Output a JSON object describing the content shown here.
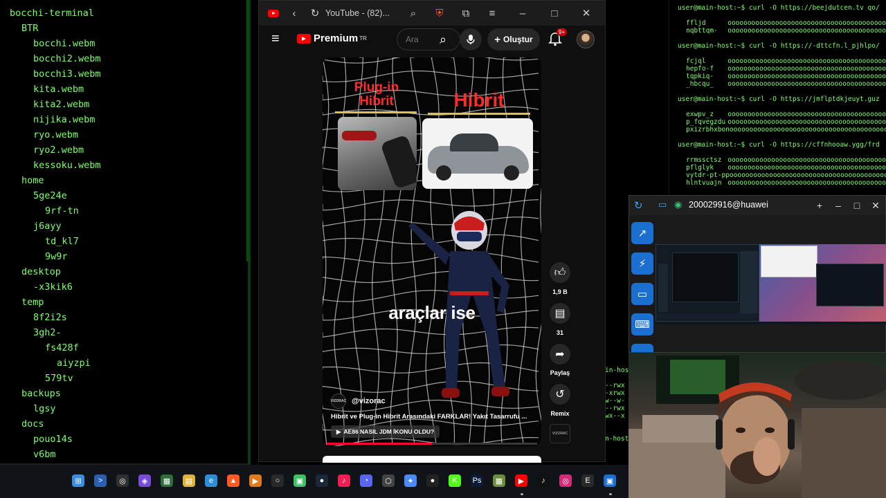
{
  "tree": {
    "title": "bocchi-terminal",
    "rows": [
      {
        "text": "BTR",
        "indent": 1
      },
      {
        "text": "bocchi.webm",
        "indent": 2
      },
      {
        "text": "bocchi2.webm",
        "indent": 2
      },
      {
        "text": "bocchi3.webm",
        "indent": 2
      },
      {
        "text": "kita.webm",
        "indent": 2
      },
      {
        "text": "kita2.webm",
        "indent": 2
      },
      {
        "text": "nijika.webm",
        "indent": 2
      },
      {
        "text": "ryo.webm",
        "indent": 2
      },
      {
        "text": "ryo2.webm",
        "indent": 2
      },
      {
        "text": "kessoku.webm",
        "indent": 2
      },
      {
        "text": "home",
        "indent": 1
      },
      {
        "text": "5ge24e",
        "indent": 2
      },
      {
        "text": "9rf-tn",
        "indent": 3
      },
      {
        "text": "j6ayy",
        "indent": 2
      },
      {
        "text": "td_kl7",
        "indent": 3
      },
      {
        "text": "9w9r",
        "indent": 3
      },
      {
        "text": "desktop",
        "indent": 1
      },
      {
        "text": "-x3kik6",
        "indent": 2
      },
      {
        "text": "temp",
        "indent": 1
      },
      {
        "text": "8f2i2s",
        "indent": 2
      },
      {
        "text": "3gh2-",
        "indent": 2
      },
      {
        "text": "fs428f",
        "indent": 3
      },
      {
        "text": "aiyzpi",
        "indent": 4
      },
      {
        "text": "579tv",
        "indent": 3
      },
      {
        "text": "backups",
        "indent": 1
      },
      {
        "text": "lgsy",
        "indent": 2
      },
      {
        "text": "docs",
        "indent": 1
      },
      {
        "text": "pouo14s",
        "indent": 2
      },
      {
        "text": "v6bm",
        "indent": 2
      }
    ]
  },
  "right_terminal": {
    "blocks": [
      {
        "prompt": "user@main-host:~$ curl -O https://beejdutcen.tv qo/",
        "items": []
      },
      {
        "prompt": null,
        "items": [
          {
            "name": "ffljd",
            "bar": "oooooooooooooooooooooooooooooooooooooooo"
          },
          {
            "name": "nqbttqm-",
            "bar": "oooooooooooooooooooooooooooooooooooooooo"
          }
        ]
      },
      {
        "prompt": "user@main-host:~$ curl -O https://-dttcfn.l_pjhlpo/",
        "items": [
          {
            "name": "fcjql",
            "bar": "oooooooooooooooooooooooooooooooooooooooo"
          },
          {
            "name": "hepfo-f",
            "bar": "oooooooooooooooooooooooooooooooooooooooo"
          },
          {
            "name": "tqpkiq-",
            "bar": "oooooooooooooooooooooooooooooooooooooooo"
          },
          {
            "name": "_hbcqu_",
            "bar": "oooooooooooooooooooooooooooooooooooooooo"
          }
        ]
      },
      {
        "prompt": "user@main-host:~$ curl -O https://jmflptdkjeuyt.guz",
        "items": [
          {
            "name": "exwpv_z",
            "bar": "oooooooooooooooooooooooooooooooooooooooo"
          },
          {
            "name": "p_fqvegzdu",
            "bar": "oooooooooooooooooooooooooooooooooooooooo"
          },
          {
            "name": "pxizrbhxbon",
            "bar": "oooooooooooooooooooooooooooooooooooooooo"
          }
        ]
      },
      {
        "prompt": "user@main-host:~$ curl -O https://cffnhooaw.ygg/frd",
        "items": [
          {
            "name": "rrmssctsz",
            "bar": "oooooooooooooooooooooooooooooooooooooooo"
          },
          {
            "name": "pflglyk",
            "bar": "oooooooooooooooooooooooooooooooooooooooo"
          },
          {
            "name": "vytdr-pt-pp",
            "bar": "oooooooooooooooooooooooooooooooooooooooo"
          },
          {
            "name": "hlntvuajn",
            "bar": "oooooooooooooooooooooooooooooooooooooooo"
          }
        ]
      }
    ]
  },
  "right_terminal2": {
    "lines": [
      "in-host",
      "",
      "--rwx",
      "-xrwx",
      "w--w-",
      "--rwx",
      "wx--x",
      "",
      "",
      "n-host"
    ]
  },
  "browser": {
    "tab_title": "YouTube - (82)...",
    "brand": "Premium",
    "brand_region": "TR",
    "search_placeholder": "Ara",
    "create_label": "Oluştur",
    "notif_count": "9+"
  },
  "video": {
    "label_plugin_line1": "Plug-in",
    "label_plugin_line2": "Hibrit",
    "label_hybrid": "Hibrit",
    "caption": "araçlar ise",
    "channel": "@vizorac",
    "channel_logo_text": "VIZORAC",
    "title": "Hibrit ve Plug-in Hibrit Arasındaki FARKLAR! Yakıt Tasarrufu ...",
    "related": "AE86 NASIL JDM İKONU OLDU?",
    "progress": 0.5,
    "likes": "1,9 B",
    "comments": "31",
    "share_label": "Paylaş",
    "remix_label": "Remix"
  },
  "remote_desktop": {
    "host": "200029916@huawei"
  },
  "colors": {
    "terminal_green": "#7dff6a",
    "youtube_red": "#ff0000",
    "accent_blue": "#1a6fd1"
  },
  "taskbar": {
    "icons": [
      "windows-start",
      "terminal",
      "obs",
      "app",
      "calculator",
      "file-explorer",
      "edge",
      "brave",
      "vlc",
      "github",
      "android",
      "steam",
      "tiktok-app",
      "discord",
      "hex-app",
      "gemini",
      "dot-app",
      "kick",
      "photoshop",
      "minecraft",
      "youtube",
      "tiktok",
      "instagram",
      "epic-games",
      "remote-desktop"
    ]
  }
}
